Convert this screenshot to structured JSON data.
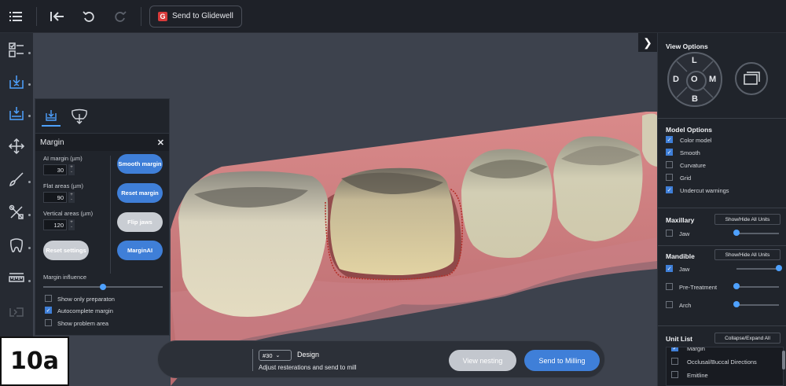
{
  "toolbar": {
    "send_glidewell": "Send to Glidewell"
  },
  "margin_panel": {
    "title": "Margin",
    "ai_margin_label": "AI margin (µm)",
    "ai_margin_value": "30",
    "flat_areas_label": "Flat areas (µm)",
    "flat_areas_value": "90",
    "vertical_areas_label": "Vertical areas (µm)",
    "vertical_areas_value": "120",
    "smooth_margin": "Smooth margin",
    "reset_margin": "Reset margin",
    "flip_jaws": "Flip jaws",
    "marginai": "MarginAI",
    "reset_settings": "Reset settings",
    "margin_influence_label": "Margin influence",
    "margin_influence_value": 0.5,
    "show_only_preparation": "Show only preparaton",
    "autocomplete_margin": "Autocomplete margin",
    "show_problem_area": "Show problem area",
    "show_only_preparation_checked": false,
    "autocomplete_margin_checked": true,
    "show_problem_area_checked": false
  },
  "view_options": {
    "title": "View Options",
    "compass": {
      "top": "L",
      "left": "D",
      "center": "O",
      "right": "M",
      "bottom": "B"
    }
  },
  "model_options": {
    "title": "Model Options",
    "items": [
      {
        "label": "Color model",
        "checked": true
      },
      {
        "label": "Smooth",
        "checked": true
      },
      {
        "label": "Curvature",
        "checked": false
      },
      {
        "label": "Grid",
        "checked": false
      },
      {
        "label": "Undercut warnings",
        "checked": true
      }
    ]
  },
  "maxillary": {
    "title": "Maxillary",
    "show_hide": "Show/Hide All Units",
    "jaw_label": "Jaw",
    "jaw_checked": false,
    "jaw_slider": 0.0
  },
  "mandible": {
    "title": "Mandible",
    "show_hide": "Show/Hide All Units",
    "jaw_label": "Jaw",
    "jaw_checked": true,
    "jaw_slider": 1.0,
    "pretreatment_label": "Pre-Treatment",
    "pretreatment_checked": false,
    "pretreatment_slider": 0.0,
    "arch_label": "Arch",
    "arch_checked": false,
    "arch_slider": 0.0
  },
  "unit_list": {
    "title": "Unit List",
    "collapse_expand": "Collapse/Expand All",
    "items": [
      {
        "label": "Margin",
        "checked": true
      },
      {
        "label": "Occlusal/Buccal Directions",
        "checked": false
      },
      {
        "label": "Emitline",
        "checked": false
      }
    ]
  },
  "bottom_bar": {
    "tooth_number": "#30",
    "step_title": "Design",
    "step_desc": "Adjust resterations and send to mill",
    "view_nesting": "View nesting",
    "send_milling": "Send to Milling"
  },
  "figure_label": "10a",
  "colors": {
    "accent_blue": "#3f7fd8",
    "panel_bg": "#20242b",
    "viewport_bg": "#3d424d",
    "margin_line": "#c0392b"
  },
  "icons": [
    "list-icon",
    "back-to-start-icon",
    "undo-icon",
    "redo-icon",
    "glidewell-logo-icon",
    "checklist-icon",
    "scan-import-icon",
    "margin-tool-icon",
    "move-icon",
    "brush-icon",
    "tools-icon",
    "tooth-icon",
    "ruler-icon",
    "export-icon",
    "chevron-right-icon",
    "view-reset-icon"
  ]
}
